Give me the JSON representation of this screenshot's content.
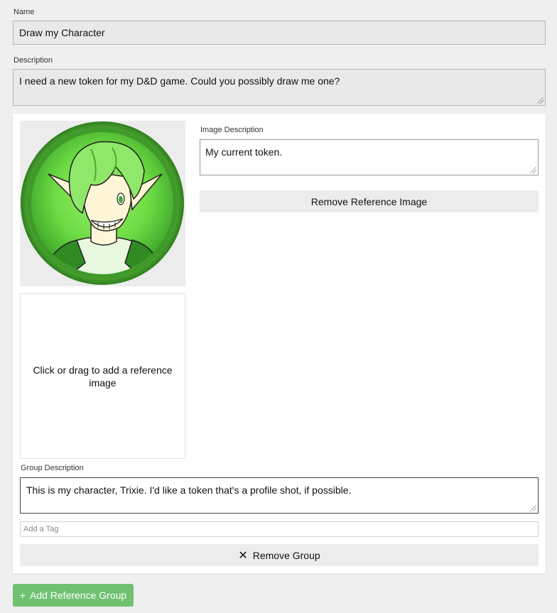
{
  "form": {
    "name_label": "Name",
    "name_value": "Draw my Character",
    "description_label": "Description",
    "description_value": "I need a new token for my D&D game. Could you possibly draw me one?"
  },
  "group": {
    "image_description_label": "Image Description",
    "image_description_value": "My current token.",
    "remove_image_label": "Remove Reference Image",
    "dropzone_text": "Click or drag to add a reference image",
    "group_description_label": "Group Description",
    "group_description_value": "This is my character, Trixie. I'd like a token that's a profile shot, if possible.",
    "tag_placeholder": "Add a Tag",
    "remove_group_icon": "✕",
    "remove_group_label": "Remove Group"
  },
  "footer": {
    "add_group_icon": "+",
    "add_group_label": "Add Reference Group"
  },
  "colors": {
    "accent_green": "#71c173",
    "token_green": "#5fcf3f"
  }
}
